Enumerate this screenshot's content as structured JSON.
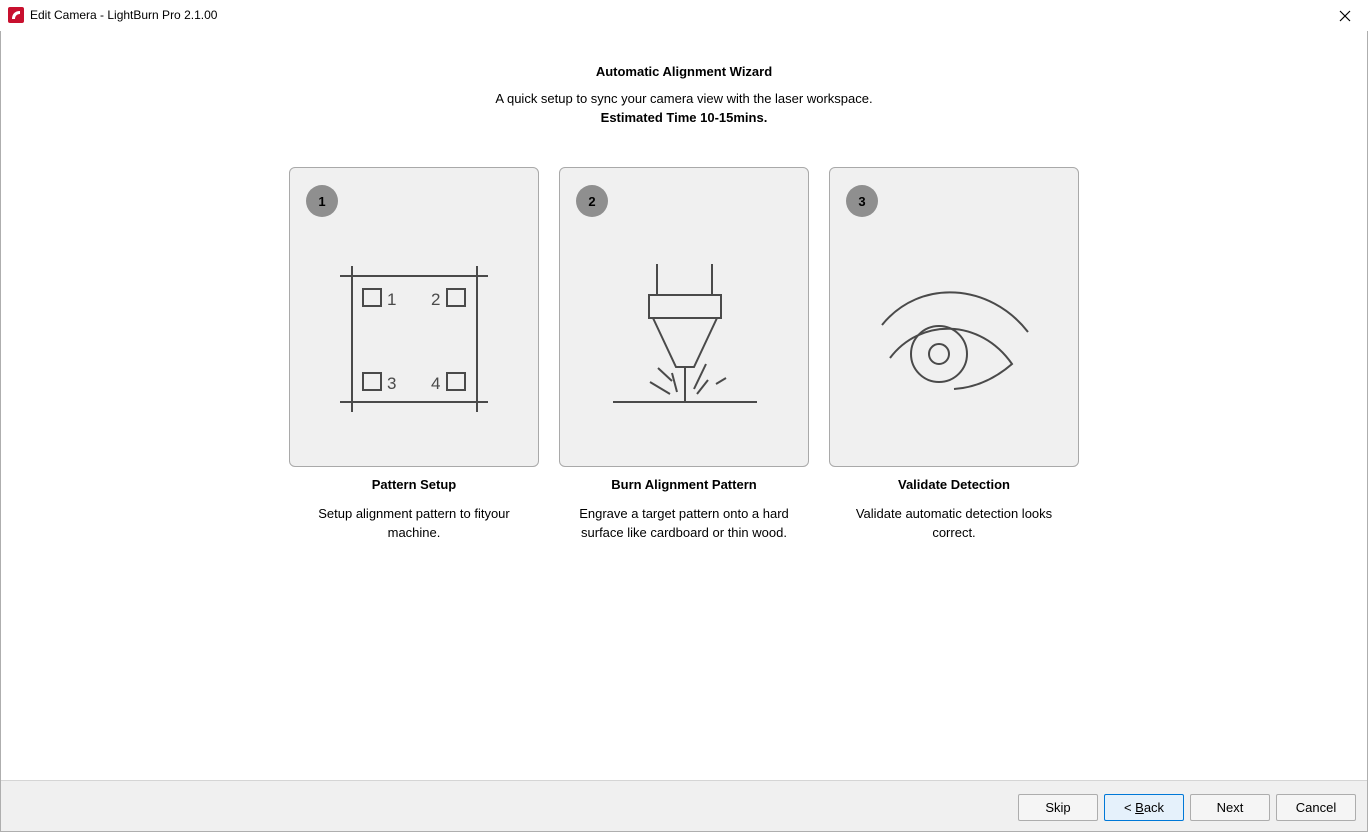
{
  "window": {
    "title": "Edit Camera - LightBurn Pro 2.1.00"
  },
  "wizard": {
    "heading": "Automatic Alignment Wizard",
    "subtext": "A quick setup to sync your camera view with the laser workspace.",
    "estimate": "Estimated Time 10-15mins."
  },
  "steps": [
    {
      "number": "1",
      "title": "Pattern Setup",
      "description": "Setup alignment pattern to fityour machine.",
      "icon": "alignment-grid-icon",
      "marker_labels": [
        "1",
        "2",
        "3",
        "4"
      ]
    },
    {
      "number": "2",
      "title": "Burn Alignment Pattern",
      "description": "Engrave a target pattern onto a hard surface like cardboard or thin wood.",
      "icon": "laser-head-icon"
    },
    {
      "number": "3",
      "title": "Validate Detection",
      "description": "Validate automatic detection looks correct.",
      "icon": "eye-icon"
    }
  ],
  "buttons": {
    "skip": "Skip",
    "back_prefix": "< ",
    "back_mnemonic": "B",
    "back_rest": "ack",
    "next": "Next",
    "cancel": "Cancel"
  },
  "colors": {
    "accent": "#0078d7",
    "badge": "#8f8f8f",
    "card_bg": "#f0f0f0",
    "icon_stroke": "#4a4a4a",
    "app_icon_red": "#c8102e"
  }
}
